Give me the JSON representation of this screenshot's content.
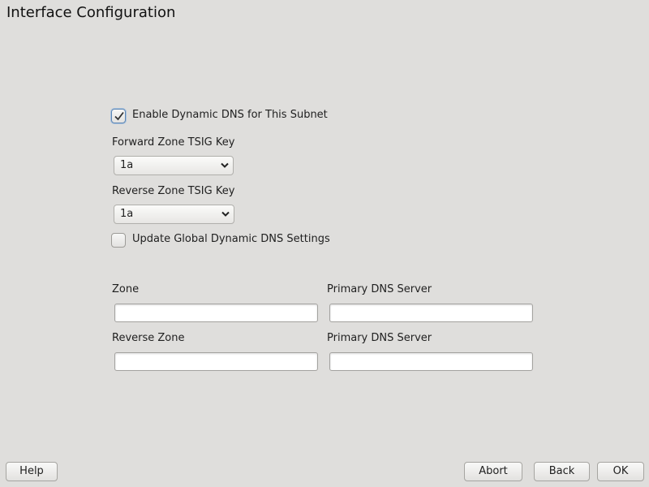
{
  "window": {
    "title": "Interface Configuration"
  },
  "form": {
    "enable_ddns": {
      "label": "Enable Dynamic DNS for This Subnet",
      "checked": true
    },
    "forward_tsig": {
      "label": "Forward Zone TSIG Key",
      "value": "1a"
    },
    "reverse_tsig": {
      "label": "Reverse Zone TSIG Key",
      "value": "1a"
    },
    "update_global": {
      "label": "Update Global Dynamic DNS Settings",
      "checked": false
    },
    "zone": {
      "label": "Zone",
      "value": ""
    },
    "zone_primary_dns": {
      "label": "Primary DNS Server",
      "value": ""
    },
    "reverse_zone": {
      "label": "Reverse Zone",
      "value": ""
    },
    "reverse_primary_dns": {
      "label": "Primary DNS Server",
      "value": ""
    }
  },
  "footer": {
    "help": "Help",
    "abort": "Abort",
    "back": "Back",
    "ok": "OK"
  }
}
